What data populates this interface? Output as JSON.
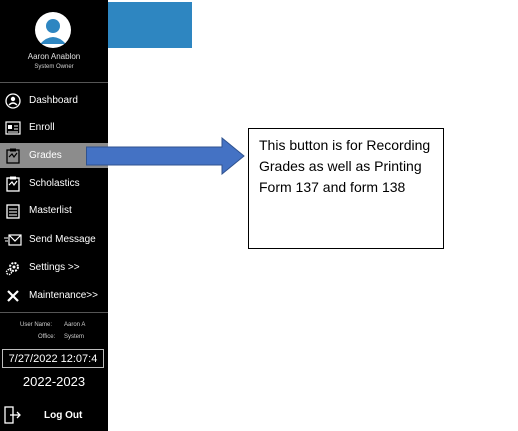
{
  "user": {
    "name": "Aaron Anablon",
    "role": "System Owner"
  },
  "nav": [
    {
      "label": "Dashboard",
      "icon": "dashboard-icon"
    },
    {
      "label": "Enroll",
      "icon": "enroll-icon"
    },
    {
      "label": "Grades",
      "icon": "grades-icon",
      "active": true
    },
    {
      "label": "Scholastics",
      "icon": "scholastics-icon"
    },
    {
      "label": "Masterlist",
      "icon": "masterlist-icon"
    },
    {
      "label": "Send Message",
      "icon": "send-message-icon"
    },
    {
      "label": "Settings >>",
      "icon": "settings-icon"
    },
    {
      "label": "Maintenance>>",
      "icon": "maintenance-icon"
    }
  ],
  "info": {
    "username_label": "User Name:",
    "username_value": "Aaron A",
    "office_label": "Office:",
    "office_value": "System"
  },
  "datetime": "7/27/2022 12:07:4",
  "school_year": "2022-2023",
  "logout_label": "Log Out",
  "callout": {
    "text": "This button is for Recording Grades as well as Printing Form 137 and form 138"
  },
  "colors": {
    "sidebar_bg": "#000000",
    "active_bg": "#8c8c8c",
    "topbar": "#2e86c1",
    "arrow_fill": "#4472c4",
    "arrow_stroke": "#2f528f"
  }
}
